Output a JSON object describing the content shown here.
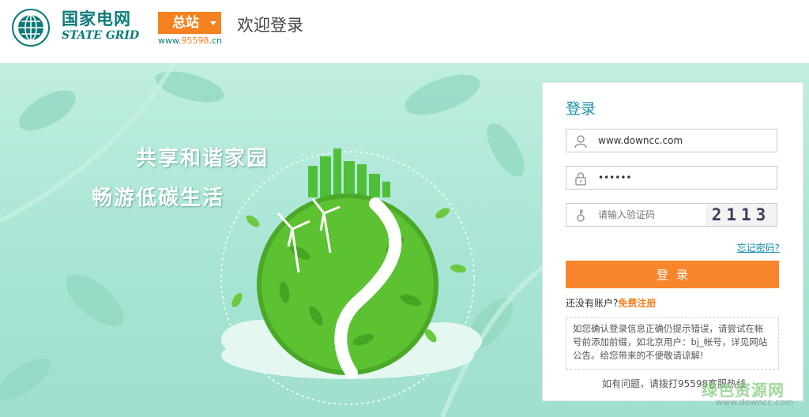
{
  "header": {
    "brand_cn": "国家电网",
    "brand_en": "STATE GRID",
    "site_button": "总站",
    "site_url_prefix": "www.",
    "site_url_number": "95598",
    "site_url_suffix": ".cn",
    "welcome": "欢迎登录"
  },
  "banner": {
    "slogan_line1": "共享和谐家园",
    "slogan_line2": "畅游低碳生活"
  },
  "login": {
    "title": "登录",
    "username_value": "www.downcc.com",
    "password_value": "••••••",
    "captcha_placeholder": "请输入验证码",
    "captcha_code": "2113",
    "forgot_link": "忘记密码?",
    "submit_label": "登录",
    "no_account_text": "还没有账户?",
    "register_link": "免费注册",
    "notice": "如您确认登录信息正确仍提示错误，请尝试在帐号前添加前缀，如北京用户：bj_帐号，详见网站公告。给您带来的不便敬请谅解!",
    "hotline": "如有问题，请拨打95598客服热线"
  },
  "watermark": {
    "line1": "绿色资源网",
    "line2": "www.downcc.com"
  },
  "colors": {
    "brand_teal": "#0b7a78",
    "accent_orange": "#f58220",
    "link_blue": "#1a8fae",
    "banner_mint": "#a6e4d4"
  }
}
